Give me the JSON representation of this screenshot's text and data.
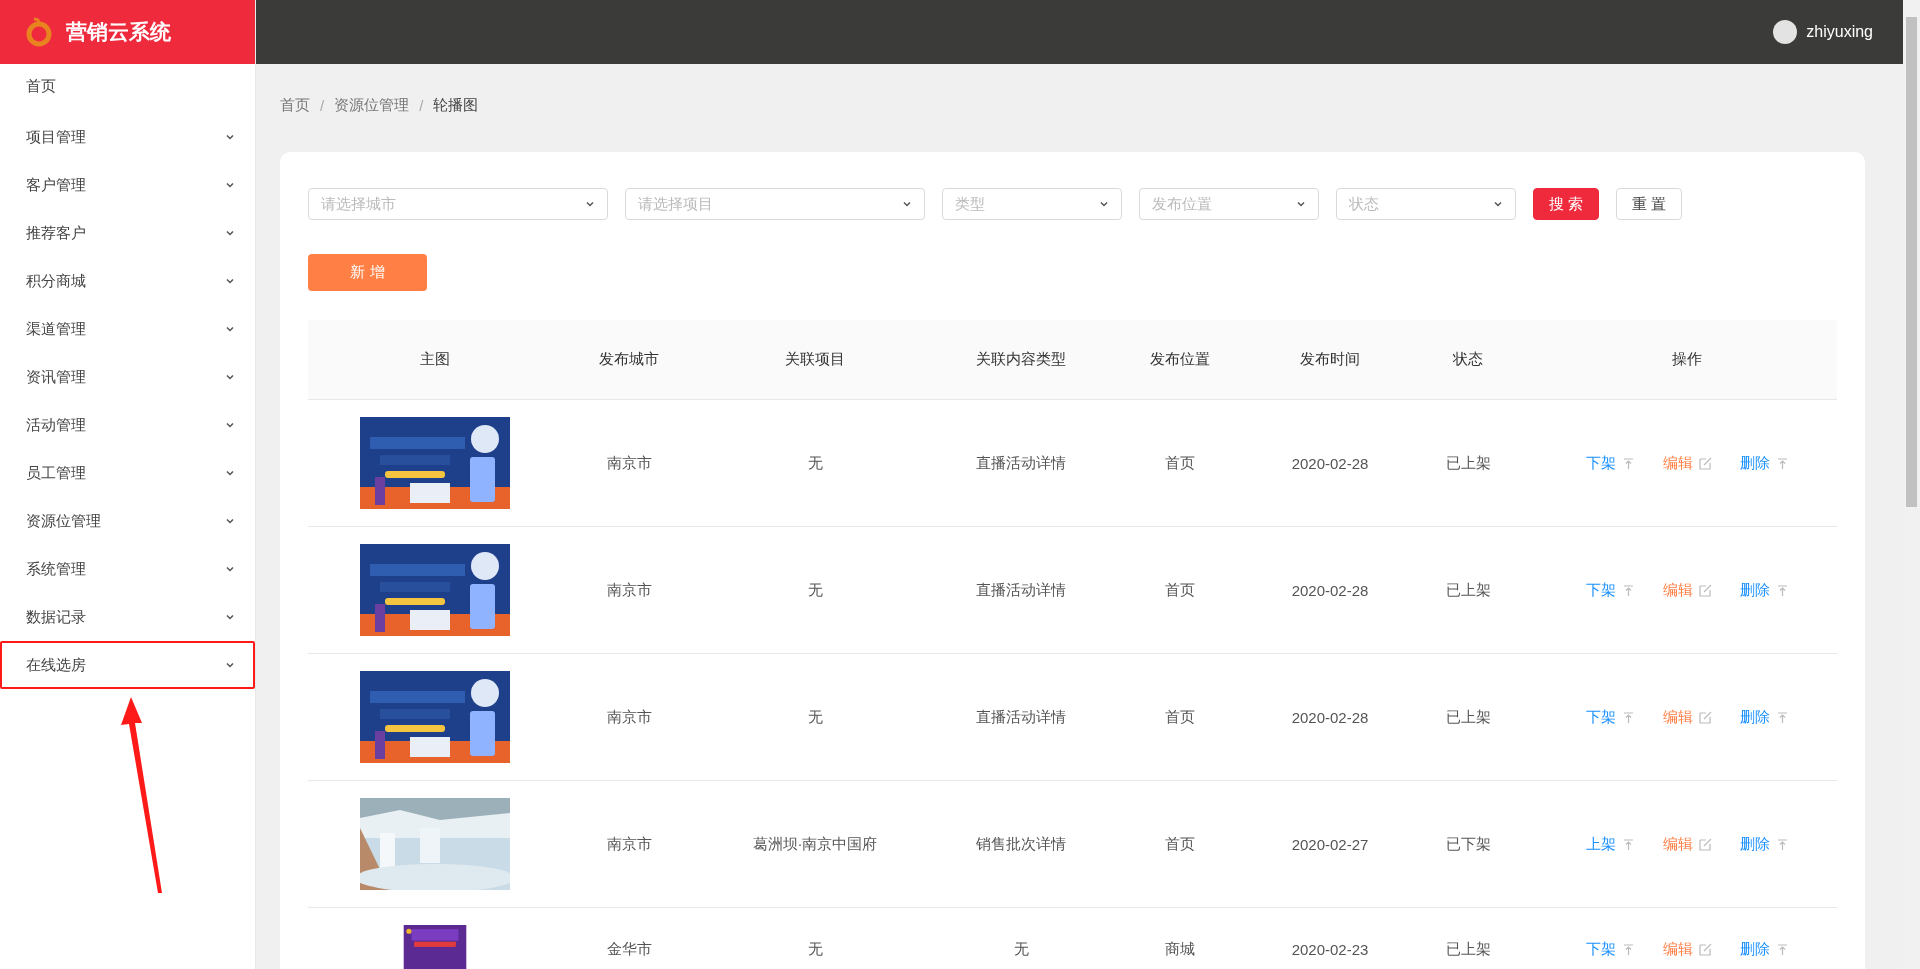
{
  "app": {
    "title": "营销云系统",
    "user": "zhiyuxing"
  },
  "sidebar": {
    "items": [
      {
        "label": "首页",
        "expandable": false,
        "highlighted": false
      },
      {
        "label": "项目管理",
        "expandable": true,
        "highlighted": false
      },
      {
        "label": "客户管理",
        "expandable": true,
        "highlighted": false
      },
      {
        "label": "推荐客户",
        "expandable": true,
        "highlighted": false
      },
      {
        "label": "积分商城",
        "expandable": true,
        "highlighted": false
      },
      {
        "label": "渠道管理",
        "expandable": true,
        "highlighted": false
      },
      {
        "label": "资讯管理",
        "expandable": true,
        "highlighted": false
      },
      {
        "label": "活动管理",
        "expandable": true,
        "highlighted": false
      },
      {
        "label": "员工管理",
        "expandable": true,
        "highlighted": false
      },
      {
        "label": "资源位管理",
        "expandable": true,
        "highlighted": false
      },
      {
        "label": "系统管理",
        "expandable": true,
        "highlighted": false
      },
      {
        "label": "数据记录",
        "expandable": true,
        "highlighted": false
      },
      {
        "label": "在线选房",
        "expandable": true,
        "highlighted": true
      }
    ]
  },
  "breadcrumb": {
    "separator": "/",
    "items": [
      "首页",
      "资源位管理",
      "轮播图"
    ]
  },
  "filters": [
    {
      "placeholder": "请选择城市"
    },
    {
      "placeholder": "请选择项目"
    },
    {
      "placeholder": "类型"
    },
    {
      "placeholder": "发布位置"
    },
    {
      "placeholder": "状态"
    }
  ],
  "buttons": [
    {
      "label": "搜 索",
      "kind": "primary"
    },
    {
      "label": "重 置",
      "kind": "plain"
    }
  ],
  "add_button": "新 增",
  "table": {
    "columns": [
      "主图",
      "发布城市",
      "关联项目",
      "关联内容类型",
      "发布位置",
      "发布时间",
      "状态",
      "操作"
    ],
    "rows": [
      {
        "cells": [
          {
            "kind": "picture"
          },
          "南京市",
          "无",
          "直播活动详情",
          "首页",
          "2020-02-28",
          "已上架",
          {
            "kind": "actions",
            "actions": [
              {
                "label": "下架",
                "kind": "toggle"
              },
              {
                "label": "编辑",
                "kind": "edit"
              },
              {
                "label": "删除",
                "kind": "delete"
              }
            ]
          }
        ]
      },
      {
        "cells": [
          {
            "kind": "picture"
          },
          "南京市",
          "无",
          "直播活动详情",
          "首页",
          "2020-02-28",
          "已上架",
          {
            "kind": "actions",
            "actions": [
              {
                "label": "下架",
                "kind": "toggle"
              },
              {
                "label": "编辑",
                "kind": "edit"
              },
              {
                "label": "删除",
                "kind": "delete"
              }
            ]
          }
        ]
      },
      {
        "cells": [
          {
            "kind": "picture"
          },
          "南京市",
          "无",
          "直播活动详情",
          "首页",
          "2020-02-28",
          "已上架",
          {
            "kind": "actions",
            "actions": [
              {
                "label": "下架",
                "kind": "toggle"
              },
              {
                "label": "编辑",
                "kind": "edit"
              },
              {
                "label": "删除",
                "kind": "delete"
              }
            ]
          }
        ]
      },
      {
        "cells": [
          {
            "kind": "picture"
          },
          "南京市",
          "葛洲坝·南京中国府",
          "销售批次详情",
          "首页",
          "2020-02-27",
          "已下架",
          {
            "kind": "actions",
            "actions": [
              {
                "label": "上架",
                "kind": "toggle"
              },
              {
                "label": "编辑",
                "kind": "edit"
              },
              {
                "label": "删除",
                "kind": "delete"
              }
            ]
          }
        ]
      },
      {
        "cells": [
          {
            "kind": "picture"
          },
          "金华市",
          "无",
          "无",
          "商城",
          "2020-02-23",
          "已上架",
          {
            "kind": "actions",
            "actions": [
              {
                "label": "下架",
                "kind": "toggle"
              },
              {
                "label": "编辑",
                "kind": "edit"
              },
              {
                "label": "删除",
                "kind": "delete"
              }
            ]
          }
        ]
      }
    ]
  }
}
